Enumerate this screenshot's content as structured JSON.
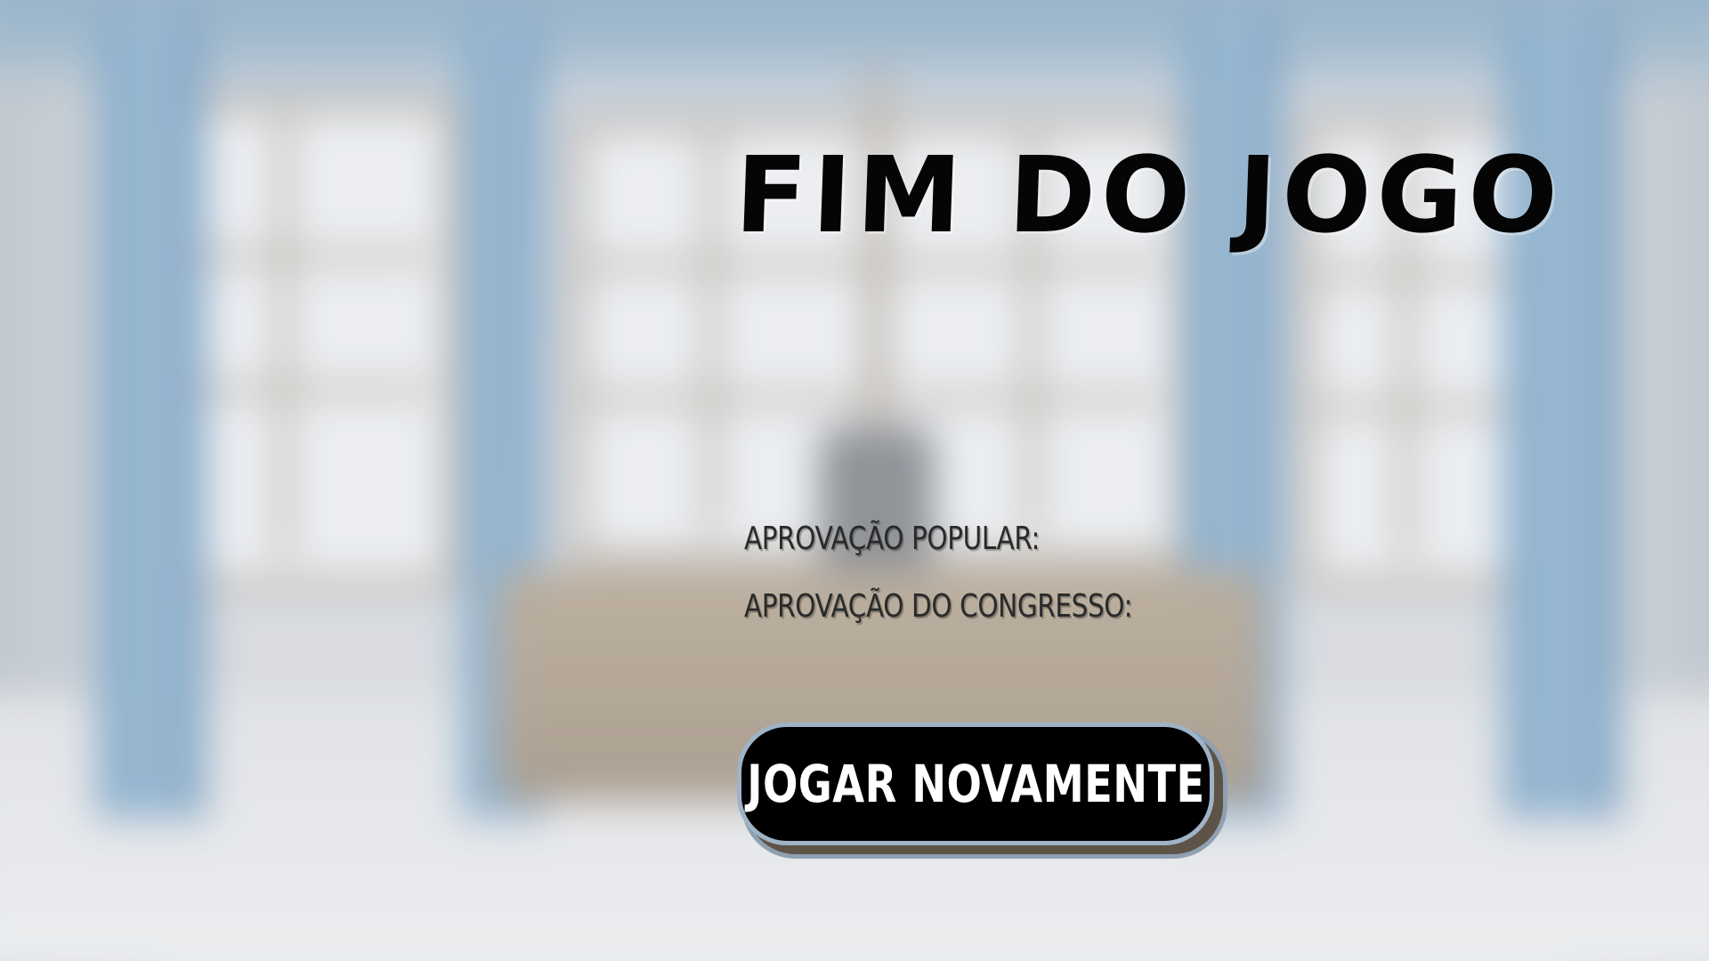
{
  "screen": {
    "title": "FIM DO JOGO"
  },
  "stats": {
    "popular_label": "APROVAÇÃO POPULAR:",
    "popular_value": "",
    "congress_label": "APROVAÇÃO DO CONGRESSO:",
    "congress_value": ""
  },
  "actions": {
    "play_again_label": "JOGAR NOVAMENTE"
  },
  "colors": {
    "title": "#050505",
    "button_bg": "#000000",
    "button_border": "#9fb3c6",
    "button_text": "#ffffff"
  }
}
